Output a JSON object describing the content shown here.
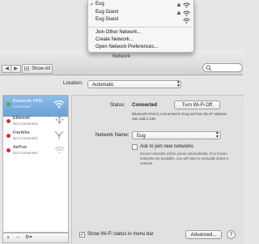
{
  "wifi_menu": {
    "networks": [
      {
        "name": "Eug",
        "checked": true
      },
      {
        "name": "Eug Guest",
        "checked": false
      },
      {
        "name": "Eug Guest",
        "checked": false
      }
    ],
    "checkmark": "✓",
    "actions": [
      "Join Other Network...",
      "Create Network...",
      "Open Network Preferences..."
    ]
  },
  "window": {
    "title": "Network",
    "back_glyph": "◀",
    "forward_glyph": "▶",
    "show_all_label": "Show All"
  },
  "location": {
    "label": "Location:",
    "value": "Automatic"
  },
  "services": [
    {
      "name": "Bluetooth PAN",
      "status": "Connected",
      "dot_color": "#3bb93b",
      "icon": "wifi-icon",
      "selected": true
    },
    {
      "name": "Ethernet",
      "status": "Not Connected",
      "dot_color": "#d52b2b",
      "icon": "ethernet-icon",
      "selected": false
    },
    {
      "name": "FireWire",
      "status": "Not Connected",
      "dot_color": "#d52b2b",
      "icon": "firewire-icon",
      "selected": false
    },
    {
      "name": "AirPort",
      "status": "Not Connected",
      "dot_color": "#d52b2b",
      "icon": "airport-icon",
      "selected": false
    }
  ],
  "sidebar_footer": {
    "add": "+",
    "remove": "−",
    "action": "⚙▾"
  },
  "detail": {
    "status_label": "Status:",
    "status_value": "Connected",
    "turn_off_label": "Turn Wi-Fi Off",
    "status_desc": "Bluetooth PAN is connected to Eug and has the IP address 192.168.2.139.",
    "network_name_label": "Network Name:",
    "network_name_value": "Eug",
    "ask_checkbox_checked": false,
    "ask_label": "Ask to join new networks",
    "ask_desc": "Known networks will be joined automatically. If no known networks are available, you will have to manually select a network.",
    "show_wifi_checked": true,
    "check_glyph": "✓",
    "show_wifi_label": "Show Wi-Fi status in menu bar",
    "advanced_label": "Advanced...",
    "help_label": "?"
  },
  "colors": {
    "selection": "#7fb2e3",
    "connected_dot": "#3bb93b",
    "disconnected_dot": "#d52b2b"
  }
}
